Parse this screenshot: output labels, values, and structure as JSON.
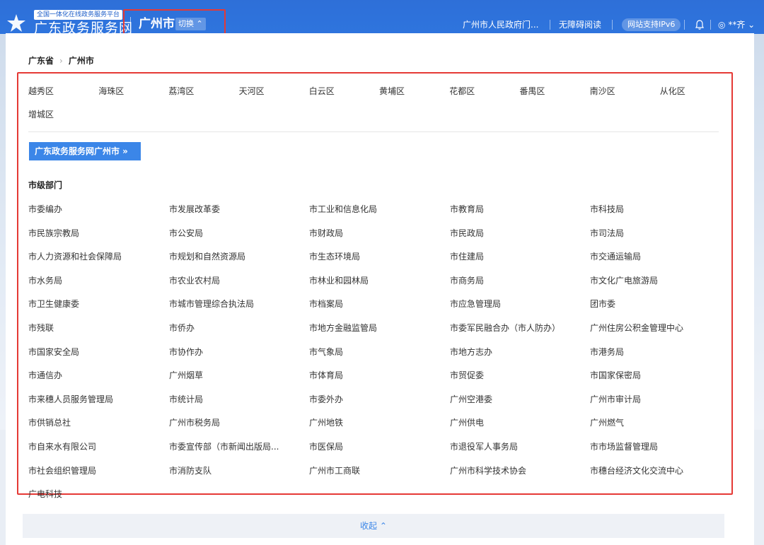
{
  "header": {
    "platform_tag": "全国一体化在线政务服务平台",
    "site_name": "广东政务服务网",
    "city": "广州市",
    "switch_label": "切换",
    "nav": {
      "gov_link": "广州市人民政府门...",
      "accessible": "无障碍阅读",
      "ipv6": "网站支持IPv6",
      "user": "**齐"
    },
    "bell_icon": "bell-icon",
    "user_icon": "user-circle-icon",
    "accent_color": "#2f77e0"
  },
  "breadcrumb": {
    "province": "广东省",
    "city": "广州市"
  },
  "districts": [
    "越秀区",
    "海珠区",
    "荔湾区",
    "天河区",
    "白云区",
    "黄埔区",
    "花都区",
    "番禺区",
    "南沙区",
    "从化区",
    "增城区"
  ],
  "portal_button": "广东政务服务网广州市 »",
  "section_title": "市级部门",
  "departments": [
    "市委编办",
    "市发展改革委",
    "市工业和信息化局",
    "市教育局",
    "市科技局",
    "市民族宗教局",
    "市公安局",
    "市财政局",
    "市民政局",
    "市司法局",
    "市人力资源和社会保障局",
    "市规划和自然资源局",
    "市生态环境局",
    "市住建局",
    "市交通运输局",
    "市水务局",
    "市农业农村局",
    "市林业和园林局",
    "市商务局",
    "市文化广电旅游局",
    "市卫生健康委",
    "市城市管理综合执法局",
    "市档案局",
    "市应急管理局",
    "团市委",
    "市残联",
    "市侨办",
    "市地方金融监管局",
    "市委军民融合办（市人防办）",
    "广州住房公积金管理中心",
    "市国家安全局",
    "市协作办",
    "市气象局",
    "市地方志办",
    "市港务局",
    "市通信办",
    "广州烟草",
    "市体育局",
    "市贸促委",
    "市国家保密局",
    "市来穗人员服务管理局",
    "市统计局",
    "市委外办",
    "广州空港委",
    "广州市审计局",
    "市供销总社",
    "广州市税务局",
    "广州地铁",
    "广州供电",
    "广州燃气",
    "市自来水有限公司",
    "市委宣传部（市新闻出版局...",
    "市医保局",
    "市退役军人事务局",
    "市市场监督管理局",
    "市社会组织管理局",
    "市消防支队",
    "广州市工商联",
    "广州市科学技术协会",
    "市穗台经济文化交流中心",
    "广电科技"
  ],
  "collapse_label": "收起"
}
